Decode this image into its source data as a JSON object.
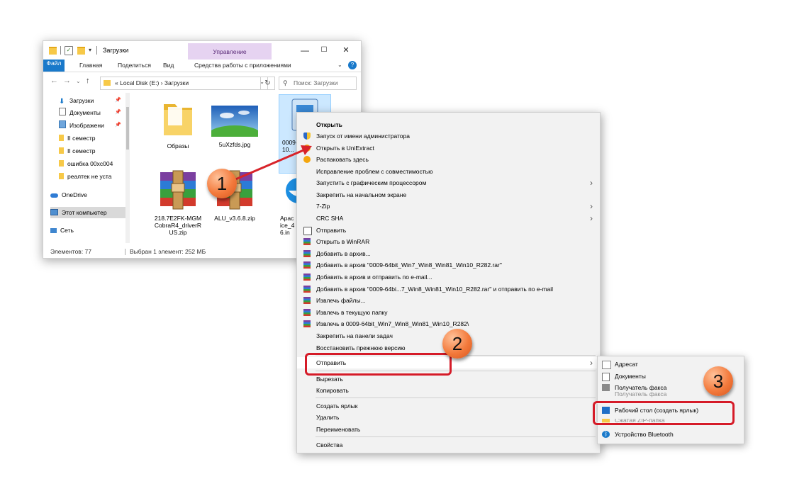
{
  "window": {
    "title": "Загрузки",
    "manage_tab": "Управление",
    "minimize": "—",
    "maximize": "☐",
    "close": "✕"
  },
  "ribbon": {
    "tabs": [
      "Файл",
      "Главная",
      "Поделиться",
      "Вид",
      "Средства работы с приложениями"
    ]
  },
  "address": {
    "path": "« Local Disk (E:)  ›  Загрузки",
    "search_placeholder": "Поиск: Загрузки"
  },
  "nav": {
    "items": [
      {
        "label": "Загрузки",
        "pinned": true
      },
      {
        "label": "Документы",
        "pinned": true
      },
      {
        "label": "Изображени",
        "pinned": true
      },
      {
        "label": "II семестр",
        "pinned": false
      },
      {
        "label": "II семестр",
        "pinned": false
      },
      {
        "label": "ошибка 00xc004",
        "pinned": false
      },
      {
        "label": "реалтек не уста",
        "pinned": false
      },
      {
        "label": "OneDrive",
        "pinned": false
      },
      {
        "label": "Этот компьютер",
        "pinned": false
      },
      {
        "label": "Сеть",
        "pinned": false
      }
    ]
  },
  "files": [
    {
      "name": "Образы"
    },
    {
      "name": "5uXzfds.jpg"
    },
    {
      "name": "0009-\n10..."
    },
    {
      "name": "218.7E2FK-MGM\nCobraR4_driverR\nUS.zip"
    },
    {
      "name": "ALU_v3.6.8.zip"
    },
    {
      "name": "Apac\nice_4\n6.in"
    }
  ],
  "status": {
    "count": "Элементов: 77",
    "selected": "Выбран 1 элемент: 252 МБ"
  },
  "context_menu": {
    "items": [
      "Открыть",
      "Запуск от имени администратора",
      "Открыть в UniExtract",
      "Распаковать здесь",
      "Исправление проблем с совместимостью",
      "Запустить с графическим процессором",
      "Закрепить на начальном экране",
      "7-Zip",
      "CRC SHA",
      "Отправить",
      "Открыть в WinRAR",
      "Добавить в архив...",
      "Добавить в архив \"0009-64bit_Win7_Win8_Win81_Win10_R282.rar\"",
      "Добавить в архив и отправить по e-mail...",
      "Добавить в архив \"0009-64bi...7_Win8_Win81_Win10_R282.rar\" и отправить по e-mail",
      "Извлечь файлы...",
      "Извлечь в текущую папку",
      "Извлечь в 0009-64bit_Win7_Win8_Win81_Win10_R282\\",
      "Закрепить на панели задач",
      "Восстановить прежнюю версию",
      "Отправить",
      "Вырезать",
      "Копировать",
      "Создать ярлык",
      "Удалить",
      "Переименовать",
      "Свойства"
    ]
  },
  "submenu": {
    "items": [
      "Адресат",
      "Документы",
      "Получатель факса",
      "Получатель факса",
      "Рабочий стол (создать ярлык)",
      "Сжатая ZIP-папка",
      "Устройство Bluetooth"
    ]
  },
  "callouts": {
    "one": "1",
    "two": "2",
    "three": "3"
  },
  "colors": {
    "accent": "#1979ca",
    "callout": "#f37a3c",
    "highlight": "#d51b28",
    "arrow": "#d8232a"
  }
}
